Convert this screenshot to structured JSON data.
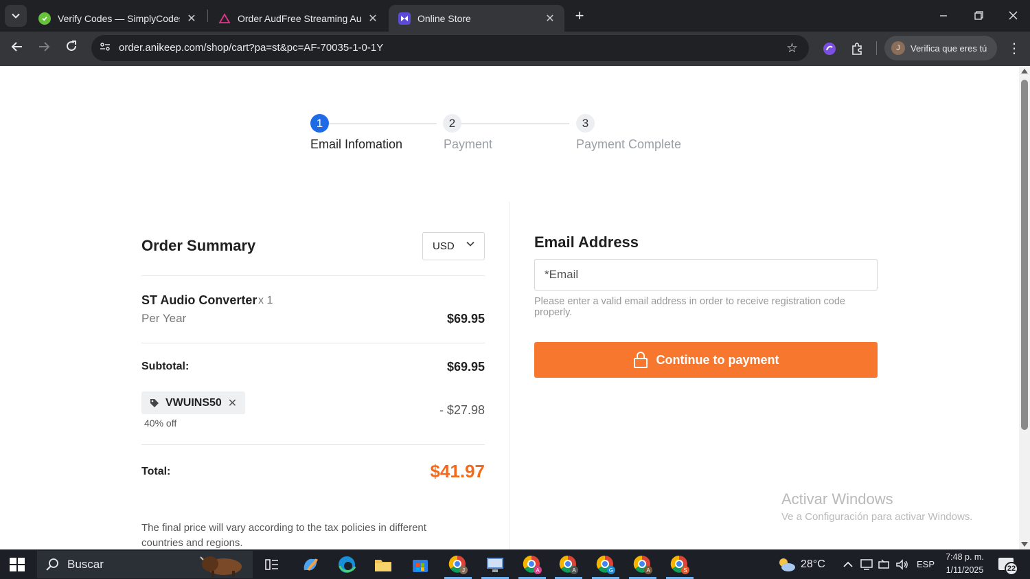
{
  "browser": {
    "tabs": [
      {
        "title": "Verify Codes — SimplyCodes",
        "favicon": "simplycodes-icon",
        "active": false
      },
      {
        "title": "Order AudFree Streaming Audio",
        "favicon": "audfree-icon",
        "active": false
      },
      {
        "title": "Online Store",
        "favicon": "store-icon",
        "active": true
      }
    ],
    "url": "order.anikeep.com/shop/cart?pa=st&pc=AF-70035-1-0-1Y",
    "profile_label": "Verifica que eres tú",
    "profile_initial": "J"
  },
  "steps": [
    {
      "number": "1",
      "label": "Email Infomation",
      "active": true
    },
    {
      "number": "2",
      "label": "Payment",
      "active": false
    },
    {
      "number": "3",
      "label": "Payment Complete",
      "active": false
    }
  ],
  "order": {
    "title": "Order Summary",
    "currency": "USD",
    "product": {
      "name": "ST Audio Converter",
      "qty": "x 1",
      "period": "Per Year",
      "price": "$69.95"
    },
    "subtotal_label": "Subtotal:",
    "subtotal_value": "$69.95",
    "coupon": {
      "code": "VWUINS50",
      "note": "40% off",
      "discount": "- $27.98"
    },
    "total_label": "Total:",
    "total_value": "$41.97",
    "tax_note": "The final price will vary according to the tax policies in different countries and regions."
  },
  "email": {
    "heading": "Email Address",
    "placeholder": "*Email",
    "value": "",
    "help": "Please enter a valid email address in order to receive registration code properly.",
    "button_label": "Continue to payment"
  },
  "watermark": {
    "line1": "Activar Windows",
    "line2": "Ve a Configuración para activar Windows."
  },
  "taskbar": {
    "search_placeholder": "Buscar",
    "weather": "28°C",
    "language": "ESP",
    "time": "7:48 p. m.",
    "date": "1/11/2025",
    "notifications": "22"
  },
  "colors": {
    "accent_orange": "#f6772d",
    "total_orange": "#f26b1d",
    "step_blue": "#1f6be6"
  }
}
